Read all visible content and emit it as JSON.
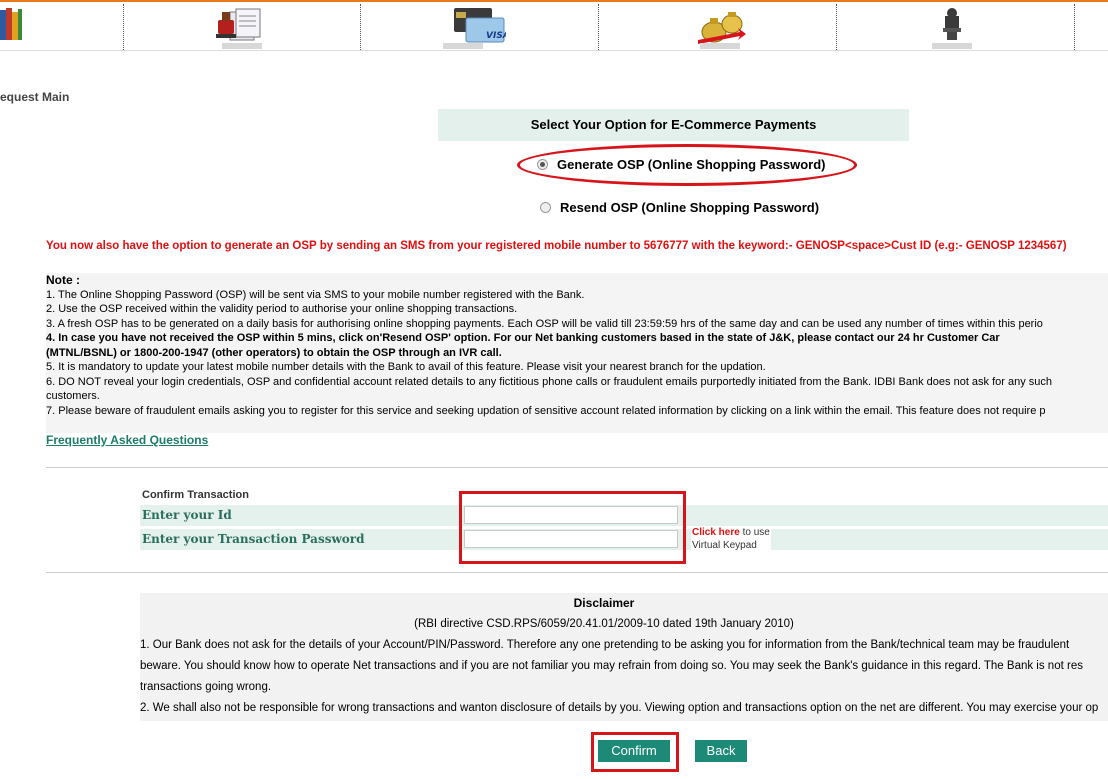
{
  "nav": {
    "icons": [
      "books-icon",
      "stamp-documents-icon",
      "visa-card-icon",
      "money-bags-icon",
      "national-emblem-icon"
    ]
  },
  "breadcrumb": "equest Main",
  "options": {
    "heading": "Select Your Option for E-Commerce Payments",
    "generate_label": "Generate OSP (Online Shopping Password)",
    "resend_label": "Resend OSP (Online Shopping Password)",
    "selected": "generate"
  },
  "sms_notice": "You now also have the option to generate an OSP by sending an SMS from your registered mobile number to 5676777 with the keyword:- GENOSP<space>Cust ID (e.g:- GENOSP 1234567)",
  "notes": {
    "title": "Note :",
    "lines": [
      "1. The Online Shopping Password (OSP) will be sent via SMS to your mobile number registered with the Bank.",
      "2. Use the OSP received within the validity period to authorise your online shopping transactions.",
      "3. A fresh OSP has to be generated on a daily basis for authorising online shopping payments. Each OSP will be valid till 23:59:59 hrs of the same day and can be used any number of times within this perio",
      "4. In case you have not received the OSP within 5 mins, click on'Resend OSP' option. For our Net banking customers based in the state of J&K, please contact our 24 hr Customer Car",
      "(MTNL/BSNL) or 1800-200-1947 (other operators) to obtain the OSP through an IVR call.",
      "5. It is mandatory to update your latest mobile number details with the Bank to avail of this feature. Please visit your nearest branch for the updation.",
      "6. DO NOT reveal your login credentials, OSP and confidential account related details to any fictitious phone calls or fraudulent emails purportedly initiated from the Bank. IDBI Bank does not ask for any such",
      "customers.",
      "7. Please beware of fraudulent emails asking you to register for this service and seeking updation of sensitive account related information by clicking on a link within the email. This feature does not require p"
    ]
  },
  "faq_link": "Frequently Asked Questions",
  "confirm": {
    "title": "Confirm Transaction",
    "id_label": "Enter your Id",
    "id_value": "",
    "password_label": "Enter your Transaction Password",
    "password_value": "",
    "click_here": "Click here",
    "click_here_suffix": " to use",
    "virtual_keypad": "Virtual Keypad"
  },
  "disclaimer": {
    "title": "Disclaimer",
    "subtitle": "(RBI directive CSD.RPS/6059/20.41.01/2009-10 dated 19th January 2010)",
    "lines": [
      "1. Our Bank does not ask for the details of your Account/PIN/Password. Therefore any one pretending to be asking you for information from the Bank/technical team may be fraudulent",
      "beware. You should know how to operate Net transactions and if you are not familiar you may refrain from doing so. You may seek the Bank's guidance in this regard. The Bank is not res",
      "transactions going wrong.",
      "2. We shall also not be responsible for wrong transactions and wanton disclosure of details by you. Viewing option and transactions option on the net are different. You may exercise your op"
    ]
  },
  "buttons": {
    "confirm": "Confirm",
    "back": "Back"
  }
}
